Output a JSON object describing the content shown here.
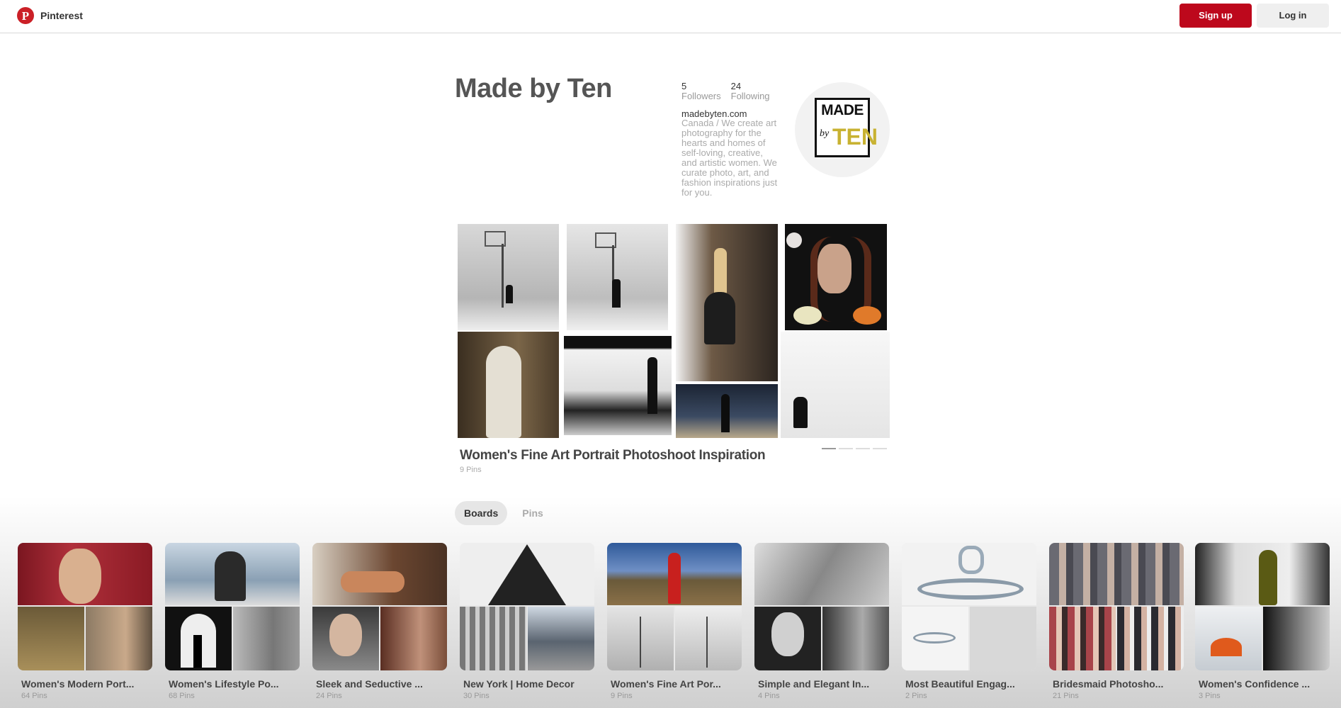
{
  "header": {
    "brand": "Pinterest",
    "logo_icon": "pinterest-logo-icon",
    "signup_label": "Sign up",
    "login_label": "Log in",
    "brand_color": "#bd081c"
  },
  "profile": {
    "name": "Made by Ten",
    "followers_count": "5",
    "followers_label": "Followers",
    "following_count": "24",
    "following_label": "Following",
    "website": "madebyten.com",
    "about": "Canada / We create art photography for the hearts and homes of self-loving, creative, and artistic women. We curate photo, art, and fashion inspirations just for you.",
    "avatar": {
      "line1": "MADE",
      "line2": "by",
      "line3": "TEN"
    }
  },
  "featured_board": {
    "title": "Women's Fine Art Portrait Photoshoot Inspiration",
    "pin_count": "9 Pins"
  },
  "tabs": [
    {
      "label": "Boards",
      "active": true
    },
    {
      "label": "Pins",
      "active": false
    }
  ],
  "boards": [
    {
      "name": "Women's Modern Port...",
      "pins": "64 Pins"
    },
    {
      "name": "Women's Lifestyle Po...",
      "pins": "68 Pins"
    },
    {
      "name": "Sleek and Seductive ...",
      "pins": "24 Pins"
    },
    {
      "name": "New York | Home Decor",
      "pins": "30 Pins"
    },
    {
      "name": "Women's Fine Art Por...",
      "pins": "9 Pins"
    },
    {
      "name": "Simple and Elegant In...",
      "pins": "4 Pins"
    },
    {
      "name": "Most Beautiful Engag...",
      "pins": "2 Pins"
    },
    {
      "name": "Bridesmaid Photosho...",
      "pins": "21 Pins"
    },
    {
      "name": "Women's Confidence ...",
      "pins": "3 Pins"
    }
  ]
}
